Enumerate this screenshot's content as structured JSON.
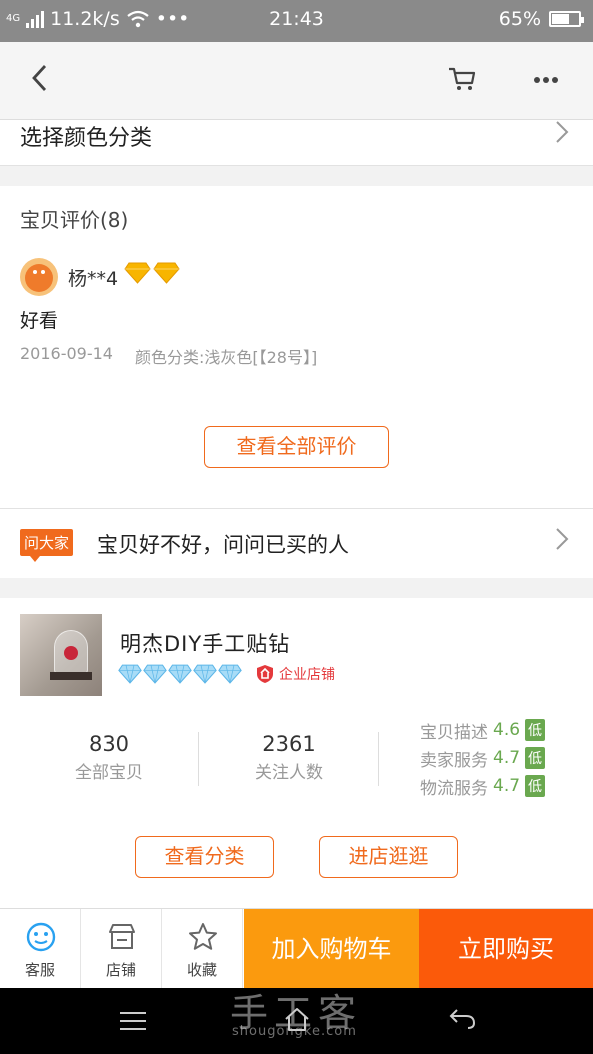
{
  "status_bar": {
    "network": "4G",
    "speed": "11.2k/s",
    "time": "21:43",
    "battery_percent_text": "65%",
    "battery_level": 0.65
  },
  "nav": {
    "back_icon": "chevron-left-icon",
    "cart_icon": "cart-icon",
    "more_icon": "more-icon"
  },
  "color_row": {
    "label": "选择颜色分类"
  },
  "reviews": {
    "title": "宝贝评价(8)",
    "items": [
      {
        "user": "杨**4",
        "content": "好看",
        "date": "2016-09-14",
        "sku": "颜色分类:浅灰色[【28号】]"
      }
    ],
    "view_all_label": "查看全部评价"
  },
  "ask": {
    "tag": "问大家",
    "text": "宝贝好不好，问问已买的人"
  },
  "shop": {
    "name": "明杰DIY手工贴钻",
    "badge": "企业店铺",
    "stats": [
      {
        "value": "830",
        "label": "全部宝贝"
      },
      {
        "value": "2361",
        "label": "关注人数"
      }
    ],
    "ratings": [
      {
        "label": "宝贝描述",
        "score": "4.6",
        "level": "低"
      },
      {
        "label": "卖家服务",
        "score": "4.7",
        "level": "低"
      },
      {
        "label": "物流服务",
        "score": "4.7",
        "level": "低"
      }
    ],
    "category_button": "查看分类",
    "enter_button": "进店逛逛"
  },
  "actions": {
    "service": "客服",
    "store": "店铺",
    "favorite": "收藏",
    "add_to_cart": "加入购物车",
    "buy_now": "立即购买"
  },
  "watermark": {
    "main": "手工客",
    "sub": "shougongke.com"
  },
  "colors": {
    "accent": "#f06a1d",
    "add_cart": "#fb9a0e",
    "buy_now": "#fb5a0a",
    "rating_green": "#6aa84f",
    "enterprise_red": "#e4393c"
  }
}
